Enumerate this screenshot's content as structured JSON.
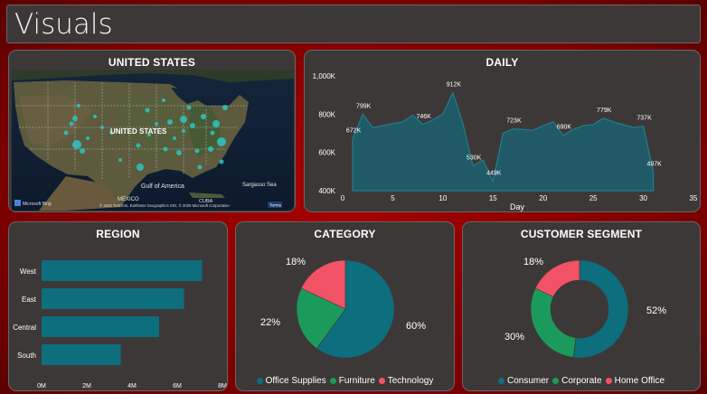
{
  "header": {
    "title": "Visuals"
  },
  "colors": {
    "teal": "#0d6e7e",
    "green": "#1b9b5b",
    "red": "#f25265",
    "panel": "#3d3838",
    "background": "#a00000"
  },
  "map": {
    "title": "UNITED STATES",
    "country_label": "UNITED STATES",
    "places": {
      "gulf": "Gulf of America",
      "sargasso": "Sargasso Sea",
      "mexico": "MÉXICO",
      "cuba": "CUBA"
    },
    "bing_logo": "Microsoft Bing",
    "attribution": "© 2025 TomTom, Earthstar Geographics SIO, © 2025 Microsoft Corporation",
    "terms": "Terms"
  },
  "daily": {
    "title": "DAILY",
    "xlabel": "Day",
    "tick_labels_y": [
      "400K",
      "600K",
      "800K",
      "1,000K"
    ],
    "tick_labels_x": [
      "0",
      "5",
      "10",
      "15",
      "20",
      "25",
      "30",
      "35"
    ],
    "point_labels": [
      "672K",
      "799K",
      "746K",
      "912K",
      "530K",
      "449K",
      "723K",
      "690K",
      "779K",
      "737K",
      "497K"
    ]
  },
  "region": {
    "title": "REGION",
    "tick_labels": [
      "0M",
      "2M",
      "4M",
      "6M",
      "8M"
    ]
  },
  "category": {
    "title": "CATEGORY",
    "labels": [
      "60%",
      "22%",
      "18%"
    ],
    "legend": [
      "Office Supplies",
      "Furniture",
      "Technology"
    ]
  },
  "segment": {
    "title": "CUSTOMER SEGMENT",
    "labels": [
      "52%",
      "30%",
      "18%"
    ],
    "legend": [
      "Consumer",
      "Corporate",
      "Home Office"
    ]
  },
  "chart_data": [
    {
      "type": "area",
      "title": "DAILY",
      "xlabel": "Day",
      "ylabel": "",
      "xlim": [
        0,
        35
      ],
      "ylim": [
        400000,
        1000000
      ],
      "x": [
        1,
        2,
        3,
        4,
        5,
        6,
        7,
        8,
        9,
        10,
        11,
        12,
        13,
        14,
        15,
        16,
        17,
        18,
        19,
        20,
        21,
        22,
        23,
        24,
        25,
        26,
        27,
        28,
        29,
        30,
        31
      ],
      "values": [
        672000,
        799000,
        730000,
        740000,
        750000,
        760000,
        795000,
        746000,
        770000,
        800000,
        912000,
        750000,
        530000,
        560000,
        449000,
        700000,
        723000,
        720000,
        715000,
        740000,
        760000,
        690000,
        720000,
        740000,
        745000,
        779000,
        760000,
        745000,
        730000,
        737000,
        497000
      ],
      "labeled_points": [
        [
          1,
          672000
        ],
        [
          2,
          799000
        ],
        [
          8,
          746000
        ],
        [
          11,
          912000
        ],
        [
          13,
          530000
        ],
        [
          15,
          449000
        ],
        [
          17,
          723000
        ],
        [
          22,
          690000
        ],
        [
          26,
          779000
        ],
        [
          30,
          737000
        ],
        [
          31,
          497000
        ]
      ],
      "grid": false
    },
    {
      "type": "bar",
      "orientation": "horizontal",
      "title": "REGION",
      "categories": [
        "West",
        "East",
        "Central",
        "South"
      ],
      "values": [
        7100000,
        6300000,
        5200000,
        3500000
      ],
      "xlim": [
        0,
        8000000
      ],
      "grid": false
    },
    {
      "type": "pie",
      "title": "CATEGORY",
      "categories": [
        "Office Supplies",
        "Furniture",
        "Technology"
      ],
      "values": [
        60,
        22,
        18
      ],
      "legend": "bottom"
    },
    {
      "type": "pie",
      "subtype": "donut",
      "title": "CUSTOMER SEGMENT",
      "categories": [
        "Consumer",
        "Corporate",
        "Home Office"
      ],
      "values": [
        52,
        30,
        18
      ],
      "legend": "bottom"
    }
  ]
}
